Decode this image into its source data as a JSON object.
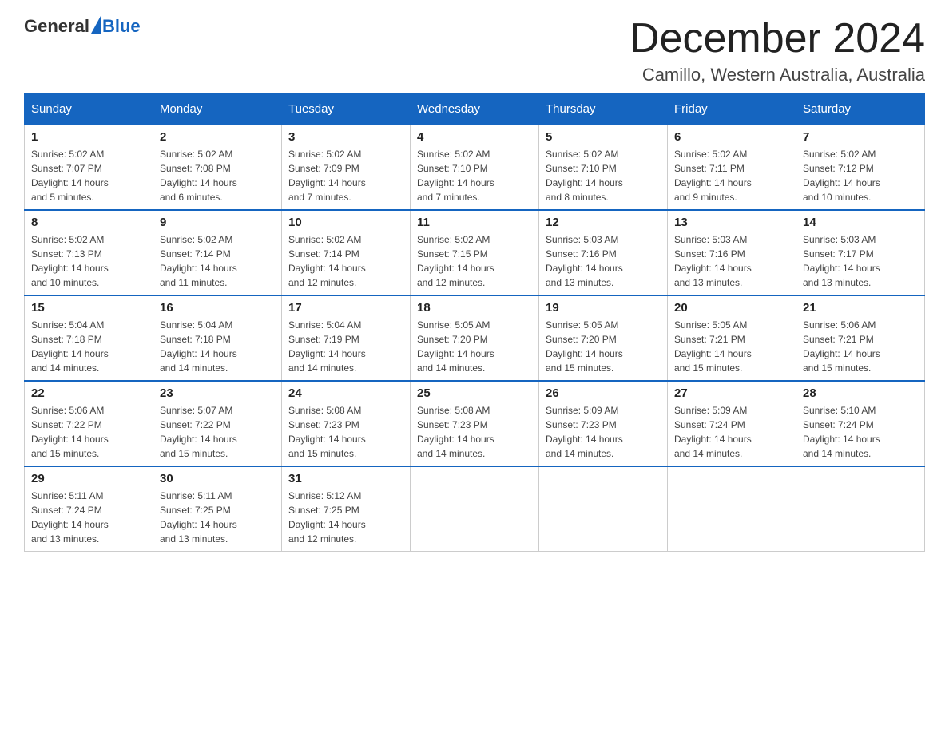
{
  "logo": {
    "general": "General",
    "blue": "Blue"
  },
  "header": {
    "month": "December 2024",
    "location": "Camillo, Western Australia, Australia"
  },
  "weekdays": [
    "Sunday",
    "Monday",
    "Tuesday",
    "Wednesday",
    "Thursday",
    "Friday",
    "Saturday"
  ],
  "weeks": [
    [
      {
        "day": "1",
        "sunrise": "5:02 AM",
        "sunset": "7:07 PM",
        "daylight": "14 hours and 5 minutes."
      },
      {
        "day": "2",
        "sunrise": "5:02 AM",
        "sunset": "7:08 PM",
        "daylight": "14 hours and 6 minutes."
      },
      {
        "day": "3",
        "sunrise": "5:02 AM",
        "sunset": "7:09 PM",
        "daylight": "14 hours and 7 minutes."
      },
      {
        "day": "4",
        "sunrise": "5:02 AM",
        "sunset": "7:10 PM",
        "daylight": "14 hours and 7 minutes."
      },
      {
        "day": "5",
        "sunrise": "5:02 AM",
        "sunset": "7:10 PM",
        "daylight": "14 hours and 8 minutes."
      },
      {
        "day": "6",
        "sunrise": "5:02 AM",
        "sunset": "7:11 PM",
        "daylight": "14 hours and 9 minutes."
      },
      {
        "day": "7",
        "sunrise": "5:02 AM",
        "sunset": "7:12 PM",
        "daylight": "14 hours and 10 minutes."
      }
    ],
    [
      {
        "day": "8",
        "sunrise": "5:02 AM",
        "sunset": "7:13 PM",
        "daylight": "14 hours and 10 minutes."
      },
      {
        "day": "9",
        "sunrise": "5:02 AM",
        "sunset": "7:14 PM",
        "daylight": "14 hours and 11 minutes."
      },
      {
        "day": "10",
        "sunrise": "5:02 AM",
        "sunset": "7:14 PM",
        "daylight": "14 hours and 12 minutes."
      },
      {
        "day": "11",
        "sunrise": "5:02 AM",
        "sunset": "7:15 PM",
        "daylight": "14 hours and 12 minutes."
      },
      {
        "day": "12",
        "sunrise": "5:03 AM",
        "sunset": "7:16 PM",
        "daylight": "14 hours and 13 minutes."
      },
      {
        "day": "13",
        "sunrise": "5:03 AM",
        "sunset": "7:16 PM",
        "daylight": "14 hours and 13 minutes."
      },
      {
        "day": "14",
        "sunrise": "5:03 AM",
        "sunset": "7:17 PM",
        "daylight": "14 hours and 13 minutes."
      }
    ],
    [
      {
        "day": "15",
        "sunrise": "5:04 AM",
        "sunset": "7:18 PM",
        "daylight": "14 hours and 14 minutes."
      },
      {
        "day": "16",
        "sunrise": "5:04 AM",
        "sunset": "7:18 PM",
        "daylight": "14 hours and 14 minutes."
      },
      {
        "day": "17",
        "sunrise": "5:04 AM",
        "sunset": "7:19 PM",
        "daylight": "14 hours and 14 minutes."
      },
      {
        "day": "18",
        "sunrise": "5:05 AM",
        "sunset": "7:20 PM",
        "daylight": "14 hours and 14 minutes."
      },
      {
        "day": "19",
        "sunrise": "5:05 AM",
        "sunset": "7:20 PM",
        "daylight": "14 hours and 15 minutes."
      },
      {
        "day": "20",
        "sunrise": "5:05 AM",
        "sunset": "7:21 PM",
        "daylight": "14 hours and 15 minutes."
      },
      {
        "day": "21",
        "sunrise": "5:06 AM",
        "sunset": "7:21 PM",
        "daylight": "14 hours and 15 minutes."
      }
    ],
    [
      {
        "day": "22",
        "sunrise": "5:06 AM",
        "sunset": "7:22 PM",
        "daylight": "14 hours and 15 minutes."
      },
      {
        "day": "23",
        "sunrise": "5:07 AM",
        "sunset": "7:22 PM",
        "daylight": "14 hours and 15 minutes."
      },
      {
        "day": "24",
        "sunrise": "5:08 AM",
        "sunset": "7:23 PM",
        "daylight": "14 hours and 15 minutes."
      },
      {
        "day": "25",
        "sunrise": "5:08 AM",
        "sunset": "7:23 PM",
        "daylight": "14 hours and 14 minutes."
      },
      {
        "day": "26",
        "sunrise": "5:09 AM",
        "sunset": "7:23 PM",
        "daylight": "14 hours and 14 minutes."
      },
      {
        "day": "27",
        "sunrise": "5:09 AM",
        "sunset": "7:24 PM",
        "daylight": "14 hours and 14 minutes."
      },
      {
        "day": "28",
        "sunrise": "5:10 AM",
        "sunset": "7:24 PM",
        "daylight": "14 hours and 14 minutes."
      }
    ],
    [
      {
        "day": "29",
        "sunrise": "5:11 AM",
        "sunset": "7:24 PM",
        "daylight": "14 hours and 13 minutes."
      },
      {
        "day": "30",
        "sunrise": "5:11 AM",
        "sunset": "7:25 PM",
        "daylight": "14 hours and 13 minutes."
      },
      {
        "day": "31",
        "sunrise": "5:12 AM",
        "sunset": "7:25 PM",
        "daylight": "14 hours and 12 minutes."
      },
      null,
      null,
      null,
      null
    ]
  ],
  "labels": {
    "sunrise": "Sunrise:",
    "sunset": "Sunset:",
    "daylight": "Daylight:"
  }
}
